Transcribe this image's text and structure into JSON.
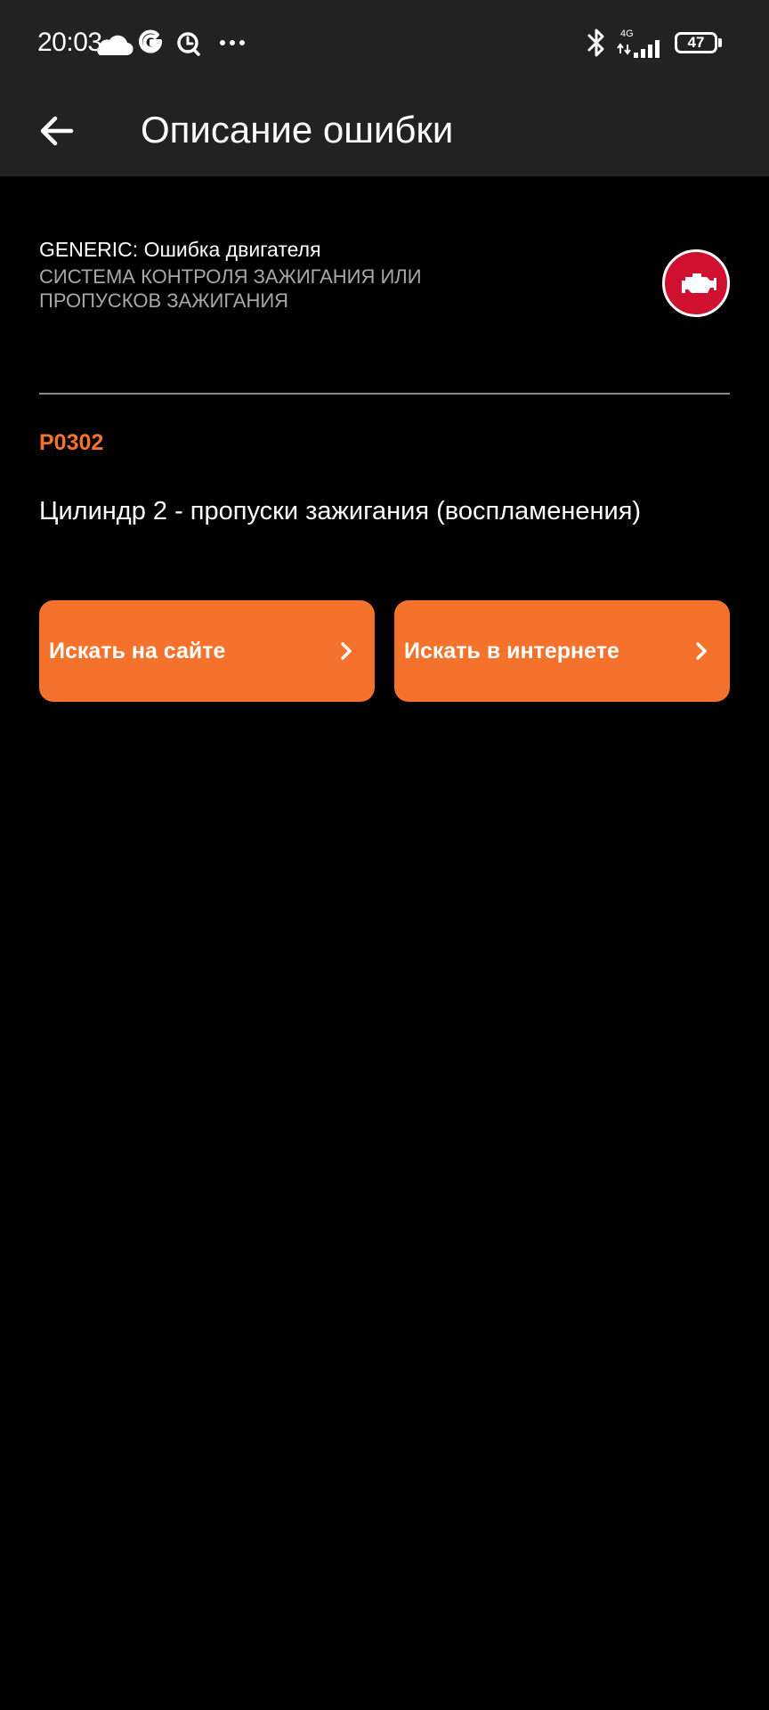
{
  "status_bar": {
    "time": "20:03",
    "network": "4G",
    "battery": "47"
  },
  "app_bar": {
    "title": "Описание ошибки"
  },
  "error": {
    "category": "GENERIC: Ошибка двигателя",
    "subsystem_line1": "СИСТЕМА КОНТРОЛЯ ЗАЖИГАНИЯ ИЛИ",
    "subsystem_line2": "ПРОПУСКОВ ЗАЖИГАНИЯ",
    "code": "P0302",
    "description": "Цилиндр 2 - пропуски зажигания (воспламенения)"
  },
  "actions": {
    "search_site_label": "Искать на сайте",
    "search_web_label": "Искать в интернете"
  },
  "colors": {
    "accent": "#f4722b",
    "code_text": "#f3732c",
    "badge": "#d0102f",
    "bar_background": "#222222",
    "background": "#000000"
  },
  "icons": {
    "back": "arrow-back-icon",
    "engine": "check-engine-icon",
    "chevron": "chevron-right-icon"
  }
}
